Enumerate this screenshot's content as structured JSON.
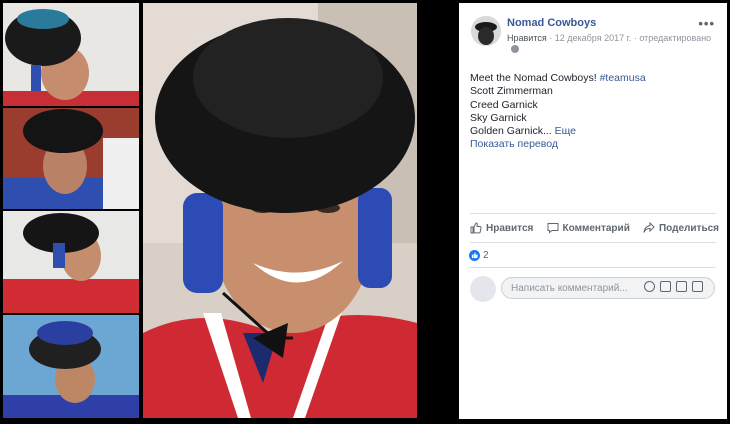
{
  "post": {
    "author": "Nomad Cowboys",
    "like_link": "Нравится",
    "date": "12 декабря 2017 г.",
    "edited": "отредактировано",
    "more_icon": "more-icon",
    "text_lines": [
      "Meet the Nomad Cowboys!",
      "#teamusa",
      "Scott Zimmerman",
      "Creed Garnick",
      "Sky Garnick",
      "Golden Garnick...",
      "Еще"
    ],
    "translate": "Показать перевод"
  },
  "actions": {
    "like": "Нравится",
    "comment": "Комментарий",
    "share": "Поделиться"
  },
  "reactions": {
    "count": "2"
  },
  "comment_box": {
    "placeholder": "Написать комментарий..."
  },
  "icons": [
    "thumbs-up-icon",
    "comment-icon",
    "share-icon",
    "emoji-icon",
    "camera-icon",
    "gif-icon",
    "sticker-icon",
    "globe-icon"
  ],
  "colors": {
    "link": "#385898",
    "panel_bg": "#ffffff",
    "photo_bg": "#000000",
    "like_badge": "#1877f2"
  }
}
